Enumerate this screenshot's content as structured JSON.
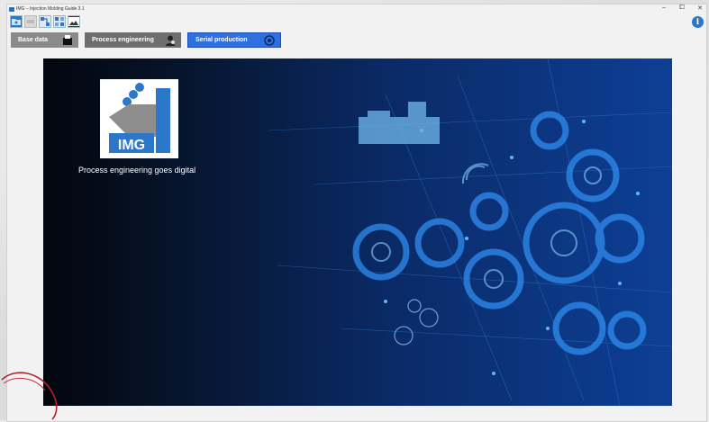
{
  "window": {
    "title": "IMG – Injection Molding Guide 3.1"
  },
  "window_controls": {
    "minimize": "–",
    "maximize": "⧠",
    "close": "✕"
  },
  "toolbar": {
    "icons": [
      "open-folder-icon",
      "disabled-icon",
      "network-icon",
      "grid-icon",
      "image-icon"
    ]
  },
  "info_button": {
    "label": "i",
    "icon": "info-icon"
  },
  "tabs": [
    {
      "label": "Base data",
      "icon": "database-icon",
      "color": "#8a8a8a"
    },
    {
      "label": "Process engineering",
      "icon": "engineer-icon",
      "color": "#6e6e6e"
    },
    {
      "label": "Serial production",
      "icon": "cycle-icon",
      "color": "#2f6fe0",
      "active": true
    }
  ],
  "banner": {
    "logo_text": "IMG",
    "tagline": "Process engineering goes digital"
  }
}
